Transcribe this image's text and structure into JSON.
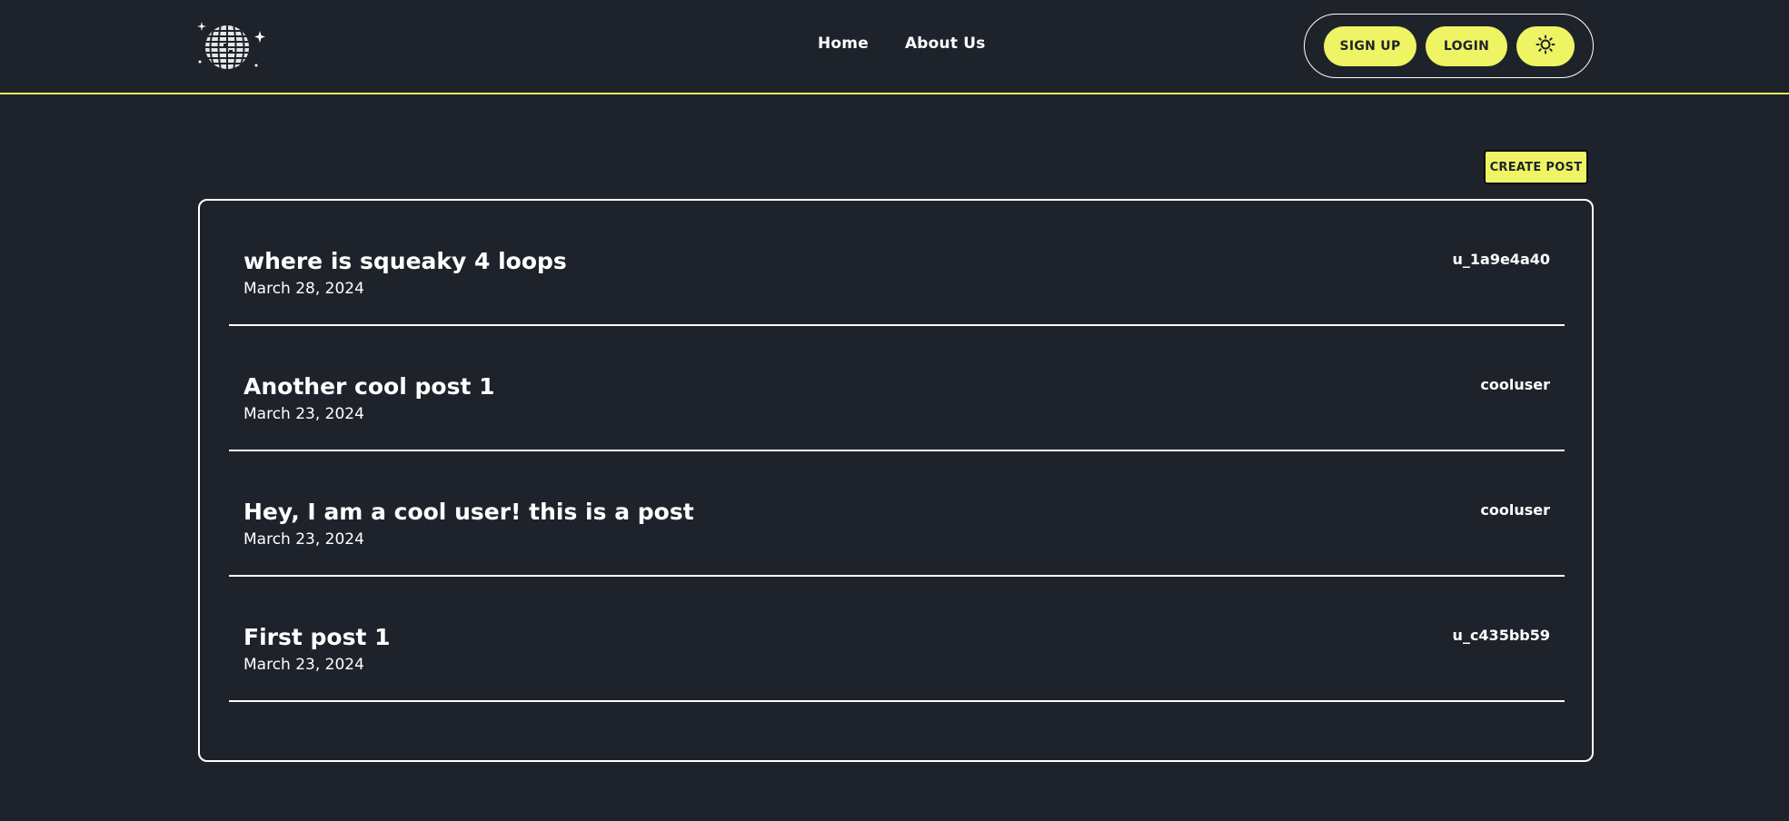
{
  "nav": {
    "home": "Home",
    "about": "About Us"
  },
  "auth": {
    "signup": "SIGN UP",
    "login": "LOGIN",
    "theme_icon": "sun-icon"
  },
  "actions": {
    "create_post": "CREATE POST"
  },
  "logo_icon": "disco-ball-icon",
  "colors": {
    "background": "#1e232b",
    "accent": "#eff464",
    "text": "#ffffff"
  },
  "posts": [
    {
      "title": "where is squeaky 4 loops",
      "date": "March 28, 2024",
      "author": "u_1a9e4a40"
    },
    {
      "title": "Another cool post 1",
      "date": "March 23, 2024",
      "author": "cooluser"
    },
    {
      "title": "Hey, I am a cool user! this is a post",
      "date": "March 23, 2024",
      "author": "cooluser"
    },
    {
      "title": "First post 1",
      "date": "March 23, 2024",
      "author": "u_c435bb59"
    }
  ]
}
